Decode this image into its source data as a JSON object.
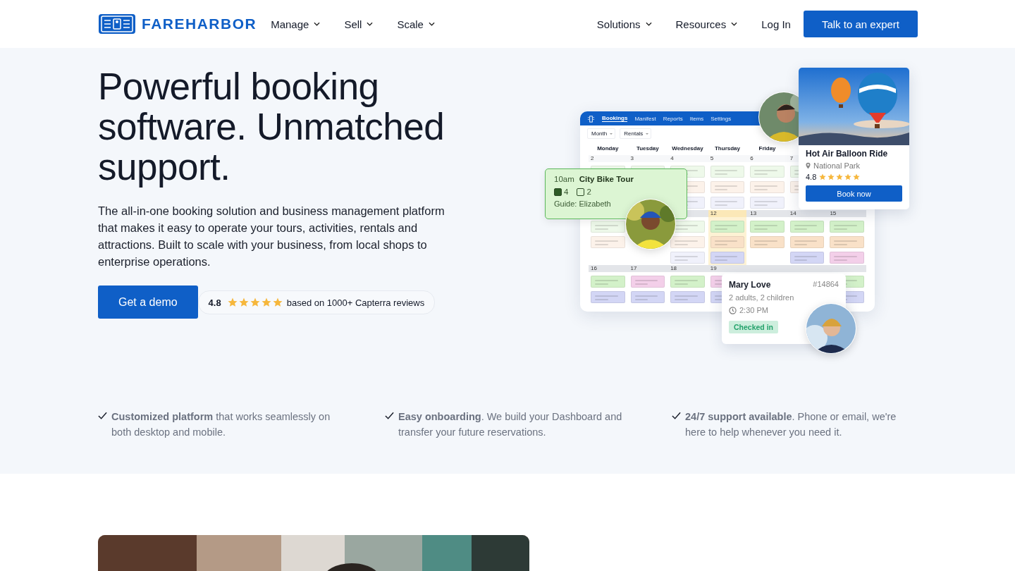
{
  "header": {
    "logo": "FAREHARBOR",
    "nav_left": [
      {
        "label": "Manage",
        "dropdown": true
      },
      {
        "label": "Sell",
        "dropdown": true
      },
      {
        "label": "Scale",
        "dropdown": true
      }
    ],
    "nav_right": [
      {
        "label": "Solutions",
        "dropdown": true
      },
      {
        "label": "Resources",
        "dropdown": true
      },
      {
        "label": "Log In",
        "dropdown": false
      }
    ],
    "cta": "Talk to an expert"
  },
  "hero": {
    "title": "Powerful booking software. Unmatched support.",
    "description": "The all-in-one booking solution and business management platform that makes it easy to operate your tours, activities, rentals and attractions. Built to scale with your business, from local shops to enterprise operations.",
    "button": "Get a demo",
    "rating": {
      "score": "4.8",
      "stars": 5,
      "text": "based on 1000+ Capterra reviews"
    }
  },
  "illustration": {
    "calendar": {
      "tabs": [
        {
          "label": "Bookings",
          "selected": true
        },
        {
          "label": "Manifest",
          "selected": false
        },
        {
          "label": "Reports",
          "selected": false
        },
        {
          "label": "Items",
          "selected": false
        },
        {
          "label": "Settings",
          "selected": false
        }
      ],
      "filters": [
        "Month",
        "Rentals"
      ],
      "weekdays": [
        "Monday",
        "Tuesday",
        "Wednesday",
        "Thursday",
        "Friday"
      ],
      "weeks": [
        {
          "days": [
            {
              "number": "2",
              "highlighted": false,
              "events": [
                {
                  "color": "#eef9ea"
                }
              ]
            },
            {
              "number": "3",
              "highlighted": false,
              "events": [
                {
                  "color": "#eef9ea"
                }
              ]
            },
            {
              "number": "4",
              "highlighted": false,
              "events": [
                {
                  "color": "#eef9ea"
                },
                {
                  "color": "#fcf2ea"
                },
                {
                  "color": "#f0f1fb"
                }
              ]
            },
            {
              "number": "5",
              "highlighted": false,
              "events": [
                {
                  "color": "#eef9ea"
                },
                {
                  "color": "#fcf2ea"
                },
                {
                  "color": "#f0f1fb"
                }
              ]
            },
            {
              "number": "6",
              "highlighted": false,
              "events": [
                {
                  "color": "#eef9ea"
                },
                {
                  "color": "#fcf2ea"
                },
                {
                  "color": "#f0f1fb"
                }
              ]
            },
            {
              "number": "7",
              "highlighted": false,
              "events": [
                {
                  "color": "#eef9ea"
                },
                {
                  "color": "#fcf2ea"
                }
              ]
            }
          ]
        },
        {
          "days": [
            {
              "highlighted": false,
              "events": [
                {
                  "color": "#eef9ea"
                },
                {
                  "color": "#fcf2ea"
                }
              ]
            }
          ],
          "trailing_days": [
            {
              "highlighted": false,
              "events": [
                {
                  "color": "#eef9ea"
                },
                {
                  "color": "#fcf2ea"
                },
                {
                  "color": "#f0f1fb"
                }
              ]
            },
            {
              "number": "12",
              "highlighted": true,
              "events": [
                {
                  "color": "#d3f1c9"
                },
                {
                  "color": "#f9e1c8"
                },
                {
                  "color": "#d3d6f5"
                }
              ]
            },
            {
              "number": "13",
              "highlighted": false,
              "events": [
                {
                  "color": "#d3f1c9"
                },
                {
                  "color": "#f9e1c8"
                }
              ]
            },
            {
              "number": "14",
              "highlighted": false,
              "events": [
                {
                  "color": "#d3f1c9"
                },
                {
                  "color": "#f9e1c8"
                },
                {
                  "color": "#d3d6f5"
                }
              ]
            },
            {
              "number": "15",
              "highlighted": false,
              "events": [
                {
                  "color": "#d3f1c9"
                },
                {
                  "color": "#f9e1c8"
                },
                {
                  "color": "#f3cfe9"
                }
              ]
            }
          ]
        },
        {
          "days": [
            {
              "number": "16",
              "highlighted": false,
              "events": [
                {
                  "color": "#d3f1c9"
                },
                {
                  "color": "#d3d6f5"
                }
              ]
            },
            {
              "number": "17",
              "highlighted": false,
              "events": [
                {
                  "color": "#f3cfe9"
                },
                {
                  "color": "#d3d6f5"
                }
              ]
            },
            {
              "number": "18",
              "highlighted": false,
              "events": [
                {
                  "color": "#d3f1c9"
                },
                {
                  "color": "#d3d6f5"
                }
              ]
            },
            {
              "number": "19",
              "highlighted": false,
              "events": [
                {
                  "color": "#f3cfe9"
                },
                {
                  "color": "#d3d6f5"
                }
              ]
            }
          ],
          "trailing_days": [
            {
              "highlighted": false,
              "events": [
                {
                  "color": "#d3f1c9"
                },
                {
                  "color": "#d3d6f5"
                }
              ]
            }
          ]
        }
      ]
    },
    "tour_card": {
      "time": "10am",
      "title": "City Bike Tour",
      "counts": [
        {
          "checked": true,
          "count": "4"
        },
        {
          "checked": false,
          "count": "2"
        }
      ],
      "guide": "Guide: Elizabeth"
    },
    "listing_card": {
      "title": "Hot Air Balloon Ride",
      "location": "National Park",
      "score": "4.8",
      "stars": 5,
      "button": "Book now"
    },
    "booking_card": {
      "name": "Mary Love",
      "booking_id": "#14864",
      "party": "2 adults, 2 children",
      "time": "2:30 PM",
      "status": "Checked in"
    }
  },
  "features": [
    {
      "text": "**Customized platform** that works seamlessly on both desktop and mobile."
    },
    {
      "text": "**Easy onboarding**. We build your Dashboard and transfer your future reservations."
    },
    {
      "text": "**24/7 support available**. Phone or email, we're here to help whenever you need it."
    }
  ]
}
